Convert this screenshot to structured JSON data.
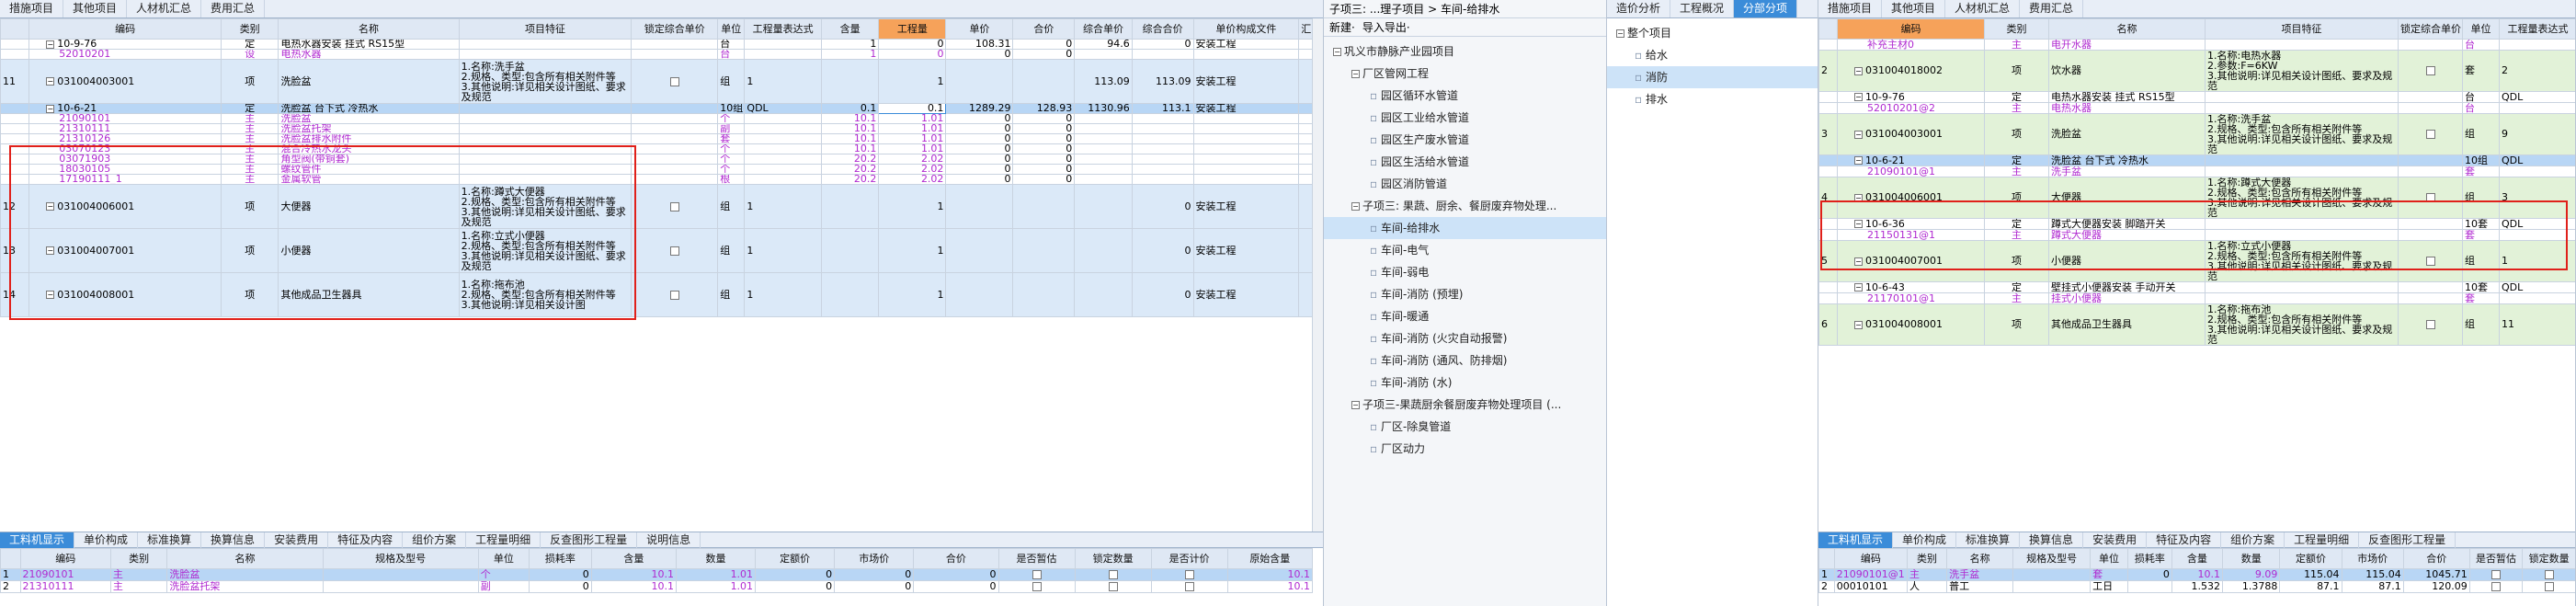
{
  "left": {
    "top_tabs": [
      "措施项目",
      "其他项目",
      "人材机汇总",
      "费用汇总"
    ],
    "headers": [
      "编码",
      "类别",
      "名称",
      "项目特征",
      "锁定综合单价",
      "单位",
      "工程量表达式",
      "含量",
      "工程量",
      "单价",
      "合价",
      "综合单价",
      "综合合价",
      "单价构成文件",
      "汇"
    ],
    "rows": [
      {
        "no": "",
        "code": "10-9-76",
        "type": "定",
        "name": "电热水器安装 挂式 RS15型",
        "feat": "",
        "lock": "",
        "unit": "台",
        "expr": "",
        "content": "1",
        "qty": "0",
        "price": "108.31",
        "total": "0",
        "uprice": "94.6",
        "utotal": "0",
        "file": "安装工程",
        "kind": "def"
      },
      {
        "no": "",
        "code": "52010201",
        "type": "设",
        "name": "电热水器",
        "feat": "",
        "lock": "",
        "unit": "台",
        "expr": "",
        "content": "1",
        "qty": "0",
        "price": "0",
        "total": "0",
        "uprice": "",
        "utotal": "",
        "file": "",
        "kind": "sub"
      },
      {
        "no": "11",
        "code": "031004003001",
        "type": "项",
        "name": "洗脸盆",
        "feat": "1.名称:洗手盆\n2.规格、类型:包含所有相关附件等\n3.其他说明:详见相关设计图纸、要求及规范",
        "lock": "cb",
        "unit": "组",
        "expr": "1",
        "content": "",
        "qty": "1",
        "price": "",
        "total": "",
        "uprice": "113.09",
        "utotal": "113.09",
        "file": "安装工程",
        "kind": "item"
      },
      {
        "no": "",
        "code": "10-6-21",
        "type": "定",
        "name": "洗脸盆 台下式 冷热水",
        "feat": "",
        "lock": "",
        "unit": "10组",
        "expr": "QDL",
        "content": "0.1",
        "qty": "0.1",
        "price": "1289.29",
        "total": "128.93",
        "uprice": "1130.96",
        "utotal": "113.1",
        "file": "安装工程",
        "kind": "sel"
      },
      {
        "no": "",
        "code": "21090101",
        "type": "主",
        "name": "洗脸盆",
        "feat": "",
        "lock": "",
        "unit": "个",
        "expr": "",
        "content": "10.1",
        "qty": "1.01",
        "price": "0",
        "total": "0",
        "uprice": "",
        "utotal": "",
        "file": "",
        "kind": "sub"
      },
      {
        "no": "",
        "code": "21310111",
        "type": "主",
        "name": "洗脸盆托架",
        "feat": "",
        "lock": "",
        "unit": "副",
        "expr": "",
        "content": "10.1",
        "qty": "1.01",
        "price": "0",
        "total": "0",
        "uprice": "",
        "utotal": "",
        "file": "",
        "kind": "sub"
      },
      {
        "no": "",
        "code": "21310126",
        "type": "主",
        "name": "洗脸盆排水附件",
        "feat": "",
        "lock": "",
        "unit": "套",
        "expr": "",
        "content": "10.1",
        "qty": "1.01",
        "price": "0",
        "total": "0",
        "uprice": "",
        "utotal": "",
        "file": "",
        "kind": "sub"
      },
      {
        "no": "",
        "code": "03070123",
        "type": "主",
        "name": "混合冷热水龙头",
        "feat": "",
        "lock": "",
        "unit": "个",
        "expr": "",
        "content": "10.1",
        "qty": "1.01",
        "price": "0",
        "total": "0",
        "uprice": "",
        "utotal": "",
        "file": "",
        "kind": "sub"
      },
      {
        "no": "",
        "code": "03071903",
        "type": "主",
        "name": "角型阀(带铜套)",
        "feat": "",
        "lock": "",
        "unit": "个",
        "expr": "",
        "content": "20.2",
        "qty": "2.02",
        "price": "0",
        "total": "0",
        "uprice": "",
        "utotal": "",
        "file": "",
        "kind": "sub"
      },
      {
        "no": "",
        "code": "18030105",
        "type": "主",
        "name": "螺纹管件",
        "feat": "",
        "lock": "",
        "unit": "个",
        "expr": "",
        "content": "20.2",
        "qty": "2.02",
        "price": "0",
        "total": "0",
        "uprice": "",
        "utotal": "",
        "file": "",
        "kind": "sub"
      },
      {
        "no": "",
        "code": "17190111_1",
        "type": "主",
        "name": "金属软管",
        "feat": "",
        "lock": "",
        "unit": "根",
        "expr": "",
        "content": "20.2",
        "qty": "2.02",
        "price": "0",
        "total": "0",
        "uprice": "",
        "utotal": "",
        "file": "",
        "kind": "sub"
      },
      {
        "no": "12",
        "code": "031004006001",
        "type": "项",
        "name": "大便器",
        "feat": "1.名称:蹲式大便器\n2.规格、类型:包含所有相关附件等\n3.其他说明:详见相关设计图纸、要求及规范",
        "lock": "cb",
        "unit": "组",
        "expr": "1",
        "content": "",
        "qty": "1",
        "price": "",
        "total": "",
        "uprice": "",
        "utotal": "0",
        "file": "安装工程",
        "kind": "item"
      },
      {
        "no": "13",
        "code": "031004007001",
        "type": "项",
        "name": "小便器",
        "feat": "1.名称:立式小便器\n2.规格、类型:包含所有相关附件等\n3.其他说明:详见相关设计图纸、要求及规范",
        "lock": "cb",
        "unit": "组",
        "expr": "1",
        "content": "",
        "qty": "1",
        "price": "",
        "total": "",
        "uprice": "",
        "utotal": "0",
        "file": "安装工程",
        "kind": "item"
      },
      {
        "no": "14",
        "code": "031004008001",
        "type": "项",
        "name": "其他成品卫生器具",
        "feat": "1.名称:拖布池\n2.规格、类型:包含所有相关附件等\n3.其他说明:详见相关设计图",
        "lock": "cb",
        "unit": "组",
        "expr": "1",
        "content": "",
        "qty": "1",
        "price": "",
        "total": "",
        "uprice": "",
        "utotal": "0",
        "file": "安装工程",
        "kind": "item"
      }
    ],
    "bottom_tabs": [
      "工料机显示",
      "单价构成",
      "标准换算",
      "换算信息",
      "安装费用",
      "特征及内容",
      "组价方案",
      "工程量明细",
      "反查图形工程量",
      "说明信息"
    ],
    "bottom_headers": [
      "编码",
      "类别",
      "名称",
      "规格及型号",
      "单位",
      "损耗率",
      "含量",
      "数量",
      "定额价",
      "市场价",
      "合价",
      "是否暂估",
      "锁定数量",
      "是否计价",
      "原始含量"
    ],
    "bottom_rows": [
      {
        "no": "1",
        "code": "21090101",
        "type": "主",
        "name": "洗脸盆",
        "spec": "",
        "unit": "个",
        "loss": "0",
        "content": "10.1",
        "qty": "1.01",
        "dprice": "0",
        "mprice": "0",
        "total": "0",
        "orig": "10.1"
      },
      {
        "no": "2",
        "code": "21310111",
        "type": "主",
        "name": "洗脸盆托架",
        "spec": "",
        "unit": "副",
        "loss": "0",
        "content": "10.1",
        "qty": "1.01",
        "dprice": "0",
        "mprice": "0",
        "total": "0",
        "orig": "10.1"
      }
    ]
  },
  "middle": {
    "title": "子项三: ...理子项目 > 车间-给排水",
    "tabs": [
      "造价分析",
      "工程概况",
      "分部分项"
    ],
    "toolbar": [
      "新建·",
      "导入导出·"
    ],
    "tree": [
      {
        "label": "巩义市静脉产业园项目",
        "indent": 0,
        "exp": "−"
      },
      {
        "label": "厂区管网工程",
        "indent": 1,
        "exp": "−"
      },
      {
        "label": "园区循环水管道",
        "indent": 2
      },
      {
        "label": "园区工业给水管道",
        "indent": 2
      },
      {
        "label": "园区生产废水管道",
        "indent": 2
      },
      {
        "label": "园区生活给水管道",
        "indent": 2
      },
      {
        "label": "园区消防管道",
        "indent": 2
      },
      {
        "label": "子项三: 果蔬、厨余、餐厨废弃物处理...",
        "indent": 1,
        "exp": "−"
      },
      {
        "label": "车间-给排水",
        "indent": 2,
        "sel": true
      },
      {
        "label": "车间-电气",
        "indent": 2
      },
      {
        "label": "车间-弱电",
        "indent": 2
      },
      {
        "label": "车间-消防 (预埋)",
        "indent": 2
      },
      {
        "label": "车间-暖通",
        "indent": 2
      },
      {
        "label": "车间-消防 (火灾自动报警)",
        "indent": 2
      },
      {
        "label": "车间-消防 (通风、防排烟)",
        "indent": 2
      },
      {
        "label": "车间-消防 (水)",
        "indent": 2
      },
      {
        "label": "子项三-果蔬厨余餐厨废弃物处理项目 (...",
        "indent": 1,
        "exp": "−"
      },
      {
        "label": "厂区-除臭管道",
        "indent": 2
      },
      {
        "label": "厂区动力",
        "indent": 2
      }
    ]
  },
  "mid_right": {
    "tree": [
      {
        "label": "整个项目",
        "indent": 0,
        "exp": "−"
      },
      {
        "label": "给水",
        "indent": 1
      },
      {
        "label": "消防",
        "indent": 1,
        "sel": true
      },
      {
        "label": "排水",
        "indent": 1
      }
    ]
  },
  "right": {
    "top_tabs": [
      "措施项目",
      "其他项目",
      "人材机汇总",
      "费用汇总"
    ],
    "headers": [
      "编码",
      "类别",
      "名称",
      "项目特征",
      "锁定综合单价",
      "单位",
      "工程量表达式"
    ],
    "rows": [
      {
        "no": "",
        "code": "补充主材0",
        "type": "主",
        "name": "电开水器",
        "feat": "",
        "lock": "",
        "unit": "台",
        "expr": "",
        "kind": "sub"
      },
      {
        "no": "2",
        "code": "031004018002",
        "type": "项",
        "name": "饮水器",
        "feat": "1.名称:电热水器\n2.参数:F=6KW\n3.其他说明:详见相关设计图纸、要求及规范",
        "lock": "cb",
        "unit": "套",
        "expr": "2",
        "kind": "item"
      },
      {
        "no": "",
        "code": "10-9-76",
        "type": "定",
        "name": "电热水器安装 挂式 RS15型",
        "feat": "",
        "lock": "",
        "unit": "台",
        "expr": "QDL",
        "kind": "def"
      },
      {
        "no": "",
        "code": "52010201@2",
        "type": "主",
        "name": "电热水器",
        "feat": "",
        "lock": "",
        "unit": "台",
        "expr": "",
        "kind": "sub"
      },
      {
        "no": "3",
        "code": "031004003001",
        "type": "项",
        "name": "洗脸盆",
        "feat": "1.名称:洗手盆\n2.规格、类型:包含所有相关附件等\n3.其他说明:详见相关设计图纸、要求及规范",
        "lock": "cb",
        "unit": "组",
        "expr": "9",
        "kind": "item"
      },
      {
        "no": "",
        "code": "10-6-21",
        "type": "定",
        "name": "洗脸盆 台下式 冷热水",
        "feat": "",
        "lock": "",
        "unit": "10组",
        "expr": "QDL",
        "kind": "sel"
      },
      {
        "no": "",
        "code": "21090101@1",
        "type": "主",
        "name": "洗手盆",
        "feat": "",
        "lock": "",
        "unit": "套",
        "expr": "",
        "kind": "sub"
      },
      {
        "no": "4",
        "code": "031004006001",
        "type": "项",
        "name": "大便器",
        "feat": "1.名称:蹲式大便器\n2.规格、类型:包含所有相关附件等\n3.其他说明:详见相关设计图纸、要求及规范",
        "lock": "cb",
        "unit": "组",
        "expr": "3",
        "kind": "item"
      },
      {
        "no": "",
        "code": "10-6-36",
        "type": "定",
        "name": "蹲式大便器安装 脚踏开关",
        "feat": "",
        "lock": "",
        "unit": "10套",
        "expr": "QDL",
        "kind": "def"
      },
      {
        "no": "",
        "code": "21150131@1",
        "type": "主",
        "name": "蹲式大便器",
        "feat": "",
        "lock": "",
        "unit": "套",
        "expr": "",
        "kind": "sub"
      },
      {
        "no": "5",
        "code": "031004007001",
        "type": "项",
        "name": "小便器",
        "feat": "1.名称:立式小便器\n2.规格、类型:包含所有相关附件等\n3.其他说明:详见相关设计图纸、要求及规范",
        "lock": "cb",
        "unit": "组",
        "expr": "1",
        "kind": "item"
      },
      {
        "no": "",
        "code": "10-6-43",
        "type": "定",
        "name": "壁挂式小便器安装 手动开关",
        "feat": "",
        "lock": "",
        "unit": "10套",
        "expr": "QDL",
        "kind": "def"
      },
      {
        "no": "",
        "code": "21170101@1",
        "type": "主",
        "name": "挂式小便器",
        "feat": "",
        "lock": "",
        "unit": "套",
        "expr": "",
        "kind": "sub"
      },
      {
        "no": "6",
        "code": "031004008001",
        "type": "项",
        "name": "其他成品卫生器具",
        "feat": "1.名称:拖布池\n2.规格、类型:包含所有相关附件等\n3.其他说明:详见相关设计图纸、要求及规范",
        "lock": "cb",
        "unit": "组",
        "expr": "11",
        "kind": "item"
      }
    ],
    "bottom_tabs": [
      "工料机显示",
      "单价构成",
      "标准换算",
      "换算信息",
      "安装费用",
      "特征及内容",
      "组价方案",
      "工程量明细",
      "反查图形工程量"
    ],
    "bottom_headers": [
      "编码",
      "类别",
      "名称",
      "规格及型号",
      "单位",
      "损耗率",
      "含量",
      "数量",
      "定额价",
      "市场价",
      "合价",
      "是否暂估",
      "锁定数量"
    ],
    "bottom_rows": [
      {
        "no": "1",
        "code": "21090101@1",
        "type": "主",
        "name": "洗手盆",
        "spec": "",
        "unit": "套",
        "loss": "0",
        "content": "10.1",
        "qty": "9.09",
        "dprice": "115.04",
        "mprice": "115.04",
        "total": "1045.71"
      },
      {
        "no": "2",
        "code": "00010101",
        "type": "人",
        "name": "普工",
        "spec": "",
        "unit": "工日",
        "loss": "",
        "content": "1.532",
        "qty": "1.3788",
        "dprice": "87.1",
        "mprice": "87.1",
        "total": "120.09"
      }
    ]
  },
  "colors": {
    "accent": "#3b8cd9",
    "highlight_header": "#f6a25a",
    "purple_text": "#b02ad0",
    "red_box": "#e0201a",
    "item_row": "#dbe9f8",
    "selected_row": "#b8d6f5"
  }
}
